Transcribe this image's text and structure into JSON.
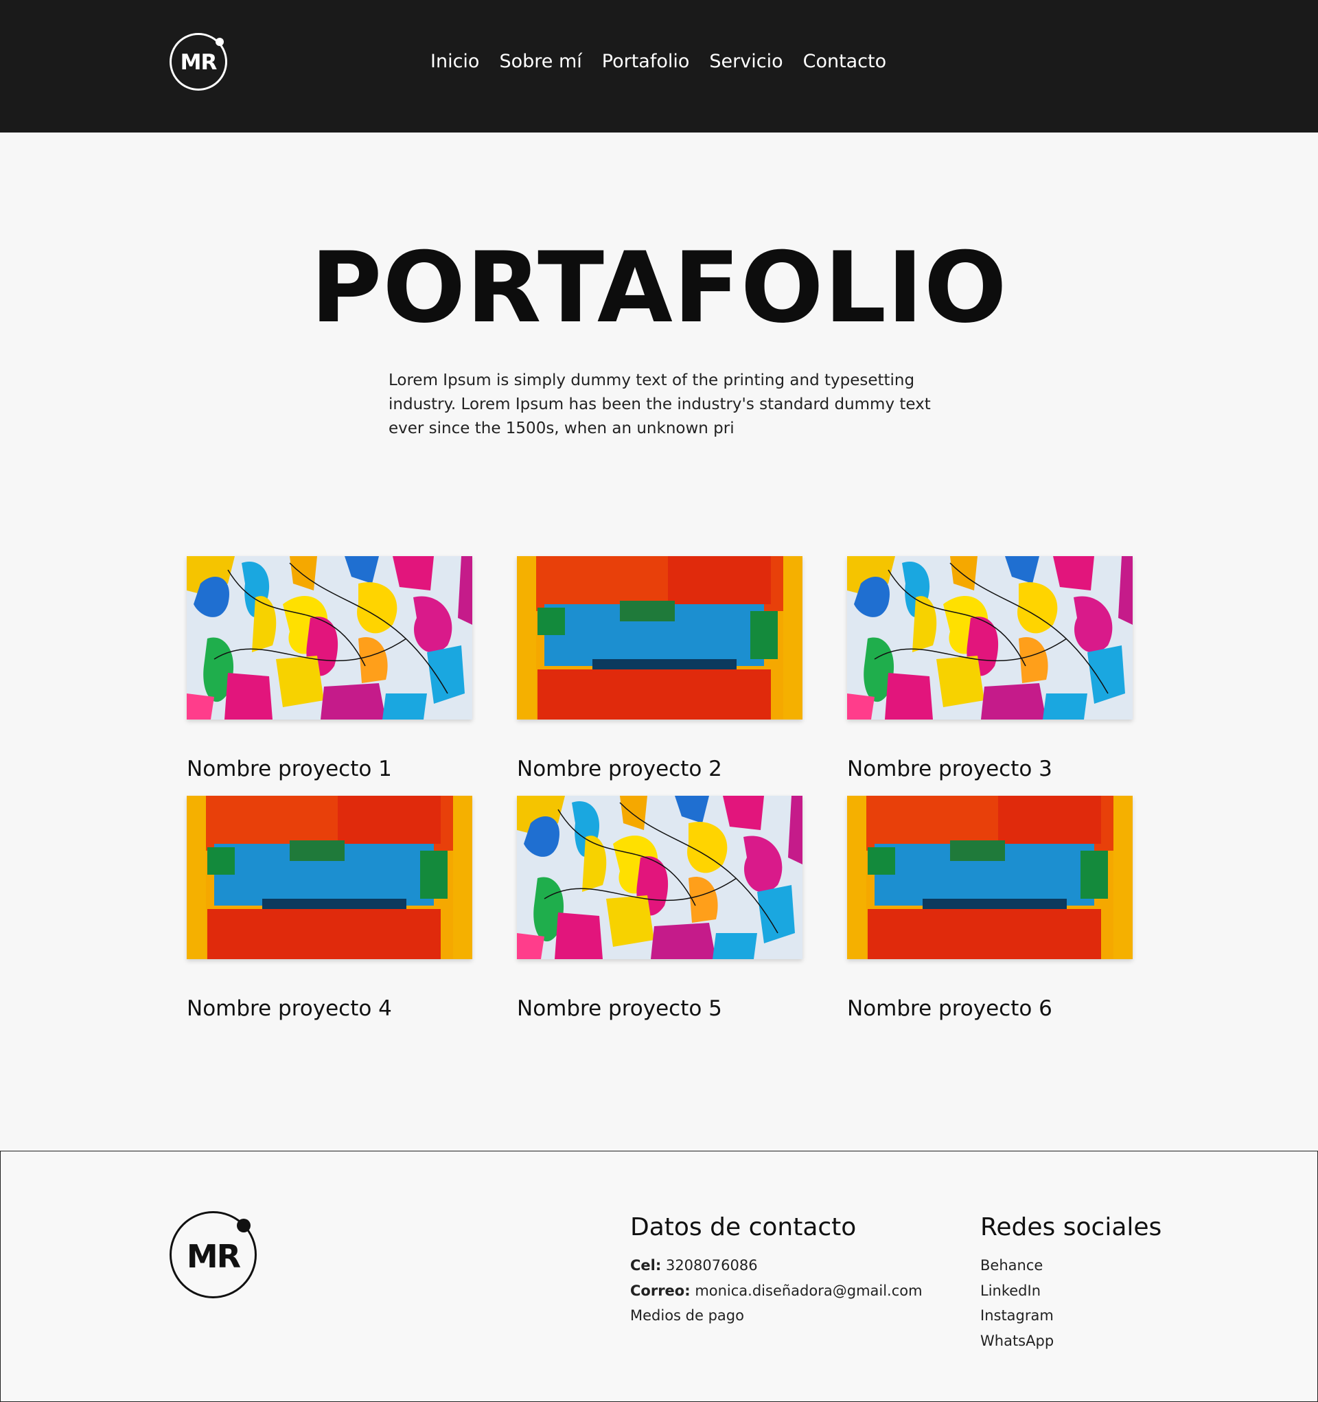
{
  "header": {
    "logo_text": "MR",
    "nav": [
      "Inicio",
      "Sobre mí",
      "Portafolio",
      "Servicio",
      "Contacto"
    ]
  },
  "hero": {
    "title": "PORTAFOLIO",
    "intro": "Lorem Ipsum is simply dummy text of the printing and typesetting industry. Lorem Ipsum has been the industry's standard dummy text ever since the 1500s, when an unknown pri"
  },
  "projects": [
    {
      "name": "Nombre proyecto 1",
      "image": "abstract-splash-painting"
    },
    {
      "name": "Nombre proyecto 2",
      "image": "abstract-block-painting"
    },
    {
      "name": "Nombre proyecto 3",
      "image": "abstract-splash-painting"
    },
    {
      "name": "Nombre proyecto 4",
      "image": "abstract-block-painting"
    },
    {
      "name": "Nombre proyecto 5",
      "image": "abstract-splash-painting"
    },
    {
      "name": "Nombre proyecto 6",
      "image": "abstract-block-painting"
    }
  ],
  "footer": {
    "logo_text": "MR",
    "contact": {
      "heading": "Datos de contacto",
      "cel_label": "Cel:",
      "cel_value": "3208076086",
      "email_label": "Correo:",
      "email_value": "monica.diseñadora@gmail.com",
      "payment": "Medios de pago"
    },
    "social": {
      "heading": "Redes sociales",
      "links": [
        "Behance",
        "LinkedIn",
        "Instagram",
        "WhatsApp"
      ]
    }
  },
  "colors": {
    "header_bg": "#1a1a1a",
    "page_bg": "#f7f7f7",
    "text": "#111111"
  }
}
